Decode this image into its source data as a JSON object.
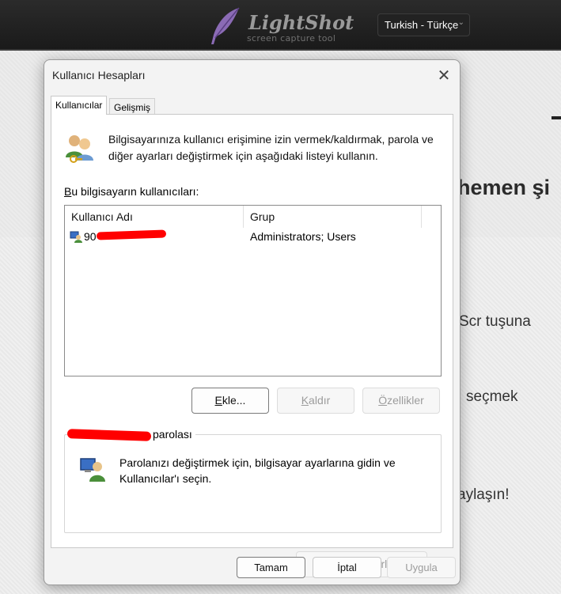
{
  "website": {
    "logo_name": "LightShot",
    "logo_tagline": "screen capture tool",
    "language_selected": "Turkish - Türkçe",
    "partial_texts": [
      "hemen şi",
      "Scr tuşuna",
      "seçmek",
      "aylaşın!"
    ]
  },
  "dialog": {
    "title": "Kullanıcı Hesapları",
    "tabs": [
      {
        "label": "Kullanıcılar",
        "selected": true
      },
      {
        "label": "Gelişmiş",
        "selected": false
      }
    ],
    "intro_text": "Bilgisayarınıza kullanıcı erişimine izin vermek/kaldırmak, parola ve diğer ayarları değiştirmek için aşağıdaki listeyi kullanın.",
    "list_label_prefix": "B",
    "list_label_rest": "u bilgisayarın kullanıcıları:",
    "columns": [
      "Kullanıcı Adı",
      "Grup"
    ],
    "users": [
      {
        "name_visible": "90",
        "group": "Administrators; Users"
      }
    ],
    "buttons": {
      "add": {
        "label": "Ekle...",
        "accel": "E",
        "enabled": true
      },
      "remove": {
        "label": "Kaldır",
        "accel": "K",
        "enabled": false
      },
      "properties": {
        "label": "Özellikler",
        "accel": "Ö",
        "enabled": false
      }
    },
    "password_group": {
      "legend_suffix": "parolası",
      "text": "Parolanızı değiştirmek için, bilgisayar ayarlarına gidin ve Kullanıcılar'ı seçin.",
      "reset_button": {
        "label": "Parolayı Sıfırla...",
        "enabled": false
      }
    },
    "footer": {
      "ok": {
        "label": "Tamam",
        "enabled": true
      },
      "cancel": {
        "label": "İptal",
        "enabled": true
      },
      "apply": {
        "label": "Uygula",
        "enabled": false
      }
    }
  },
  "colors": {
    "redaction": "#ff0000",
    "dialog_bg": "#f3f3f3",
    "topbar": "#1f1f1f"
  }
}
